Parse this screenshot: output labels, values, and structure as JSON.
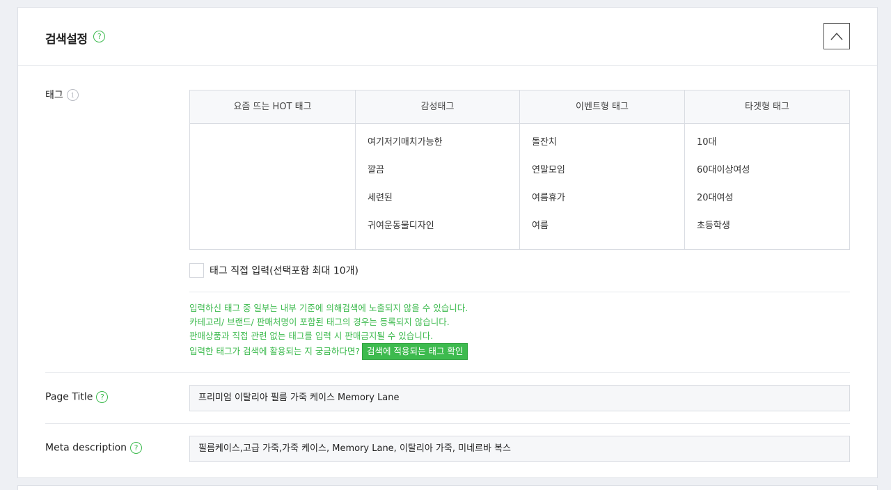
{
  "section": {
    "title": "검색설정",
    "help": "?"
  },
  "tag": {
    "label": "태그",
    "info": "i",
    "columns": [
      {
        "header": "요즘 뜨는 HOT 태그",
        "items": []
      },
      {
        "header": "감성태그",
        "items": [
          "여기저기매치가능한",
          "깔끔",
          "세련된",
          "귀여운동물디자인"
        ]
      },
      {
        "header": "이벤트형 태그",
        "items": [
          "돌잔치",
          "연말모임",
          "여름휴가",
          "여름"
        ]
      },
      {
        "header": "타겟형 태그",
        "items": [
          "10대",
          "60대이상여성",
          "20대여성",
          "초등학생"
        ]
      }
    ],
    "direct_input_label": "태그 직접 입력(선택포함 최대 10개)",
    "notices": [
      "입력하신 태그 중 일부는 내부 기준에 의해검색에 노출되지 않을 수 있습니다.",
      "카테고리/ 브랜드/ 판매처명이 포함된 태그의 경우는 등록되지 않습니다.",
      "판매상품과 직접 관련 없는 태그를 입력 시 판매금지될 수 있습니다.",
      "입력한 태그가 검색에 활용되는 지 궁금하다면?"
    ],
    "check_button": "검색에 적용되는 태그 확인"
  },
  "page_title": {
    "label": "Page Title",
    "help": "?",
    "value": "프리미엄 이탈리아 필름 가죽 케이스 Memory Lane"
  },
  "meta_description": {
    "label": "Meta description",
    "help": "?",
    "value": "필름케이스,고급 가죽,가죽 케이스, Memory Lane, 이탈리아 가죽, 미네르바 복스"
  },
  "colors": {
    "accent": "#3dba4e",
    "border": "#d9dce2",
    "background": "#eef0f4"
  }
}
